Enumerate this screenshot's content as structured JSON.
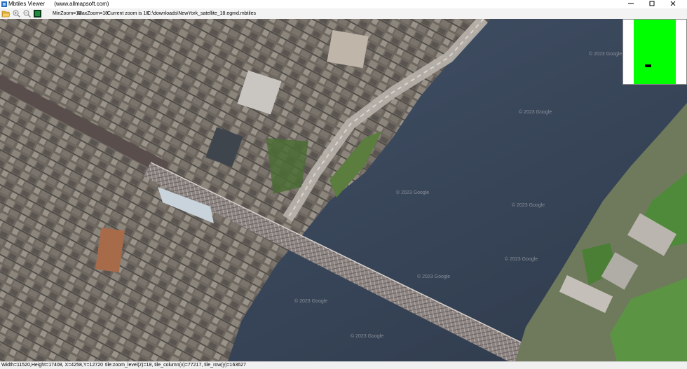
{
  "window": {
    "title": "Mbtiles Viewer",
    "website": "(www.allmapsoft.com)",
    "buttons": [
      "minimize",
      "maximize",
      "close"
    ]
  },
  "toolbar": {
    "icons": [
      "open-folder-icon",
      "zoom-in-icon",
      "zoom-out-icon",
      "app-logo-icon"
    ],
    "min_zoom": "MinZoom=18",
    "max_zoom": "MaxZoom=18",
    "current_zoom": "Current zoom is 18",
    "file_path": "C:\\downloads\\NewYork_satellite_18.egmd.mbtiles"
  },
  "map": {
    "watermark_text": "© 2023 Google",
    "colors": {
      "water": "#3c4a5c",
      "city": "#6f6a63",
      "park": "#4f7a3a",
      "bridge": "#8a7f7a"
    }
  },
  "minimap": {
    "colors": {
      "viewport": "#00ff00",
      "marker": "#000000"
    }
  },
  "status": {
    "dimensions": "Width=11520,Height=17408, X=4258,Y=12720",
    "tile_info": "tile:zoom_level(z)=18, tile_column(x)=77217, tile_row(y)=163627"
  }
}
